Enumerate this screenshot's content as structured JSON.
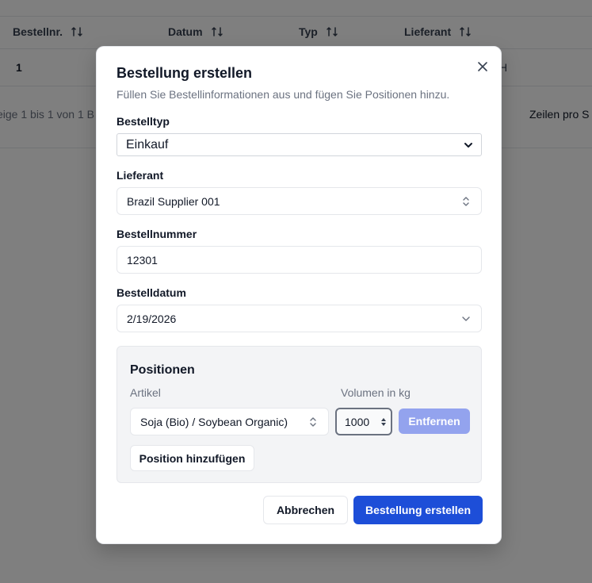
{
  "background": {
    "table": {
      "columns": [
        {
          "label": "Bestellnr."
        },
        {
          "label": "Datum"
        },
        {
          "label": "Typ"
        },
        {
          "label": "Lieferant"
        }
      ],
      "row": {
        "id": "1",
        "right_fragment": "H"
      },
      "pager_text": "eige 1 bis 1 von 1 B",
      "rows_per_page_label": "Zeilen pro S"
    }
  },
  "dialog": {
    "title": "Bestellung erstellen",
    "description": "Füllen Sie Bestellinformationen aus und fügen Sie Positionen hinzu.",
    "order_type": {
      "label": "Bestelltyp",
      "value": "Einkauf"
    },
    "supplier": {
      "label": "Lieferant",
      "value": "Brazil Supplier 001"
    },
    "order_number": {
      "label": "Bestellnummer",
      "value": "12301"
    },
    "order_date": {
      "label": "Bestelldatum",
      "value": "2/19/2026"
    },
    "positions": {
      "title": "Positionen",
      "article_label": "Artikel",
      "volume_label": "Volumen in kg",
      "items": [
        {
          "article": "Soja (Bio) / Soybean Organic)",
          "volume": "1000"
        }
      ],
      "remove_label": "Entfernen",
      "add_label": "Position hinzufügen"
    },
    "cancel_label": "Abbrechen",
    "submit_label": "Bestellung erstellen"
  },
  "icons": {
    "sort": "sort-arrows-icon",
    "close": "close-icon",
    "chevron_down": "chevron-down-icon",
    "chevron_updown": "chevron-up-down-icon",
    "spinner": "number-spinner-icon"
  },
  "colors": {
    "primary": "#1d4ed8",
    "primary_disabled": "#93a3ee",
    "overlay": "rgba(0,0,0,0.5)"
  }
}
